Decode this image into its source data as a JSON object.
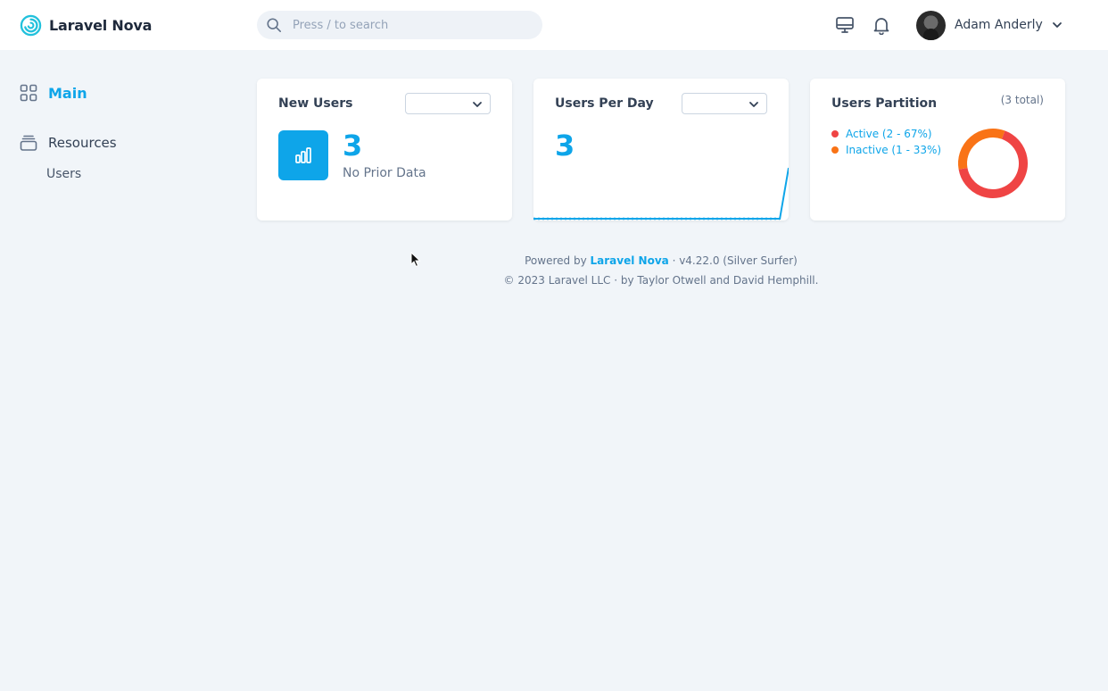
{
  "app": {
    "name": "Laravel Nova"
  },
  "search": {
    "placeholder": "Press / to search"
  },
  "header": {
    "user_name": "Adam Anderly"
  },
  "sidebar": {
    "main_label": "Main",
    "resources_label": "Resources",
    "items": [
      {
        "label": "Users"
      }
    ]
  },
  "cards": {
    "new_users": {
      "title": "New Users",
      "value": "3",
      "note": "No Prior Data",
      "select_value": ""
    },
    "users_per_day": {
      "title": "Users Per Day",
      "value": "3",
      "select_value": "",
      "trend": [
        0,
        0,
        0,
        0,
        0,
        0,
        0,
        0,
        0,
        0,
        0,
        0,
        0,
        0,
        0,
        0,
        0,
        0,
        0,
        0,
        0,
        0,
        0,
        0,
        0,
        0,
        0,
        0,
        0,
        3
      ]
    },
    "users_partition": {
      "title": "Users Partition",
      "total": "(3 total)",
      "slices": [
        {
          "label": "Active (2 - 67%)",
          "value": 2,
          "color": "#ef4444"
        },
        {
          "label": "Inactive (1 - 33%)",
          "value": 1,
          "color": "#f97316"
        }
      ]
    }
  },
  "footer": {
    "powered_prefix": "Powered by",
    "powered_link": "Laravel Nova",
    "version": "· v4.22.0 (Silver Surfer)",
    "copyright": "© 2023 Laravel LLC · by Taylor Otwell and David Hemphill."
  },
  "colors": {
    "accent": "#0ea5e9",
    "background": "#f1f5f9"
  }
}
